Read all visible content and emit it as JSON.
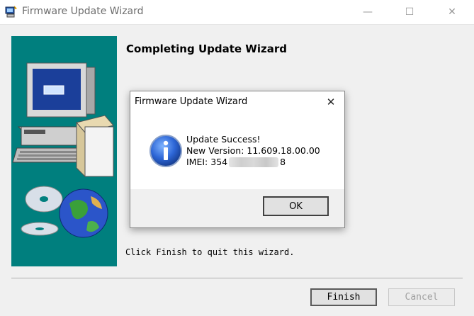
{
  "window": {
    "title": "Firmware Update Wizard",
    "controls": {
      "minimize": "—",
      "maximize": "☐",
      "close": "✕"
    }
  },
  "wizard": {
    "heading": "Completing Update Wizard",
    "hint": "Click Finish to quit this wizard.",
    "buttons": {
      "finish": "Finish",
      "cancel": "Cancel"
    },
    "icons": {
      "app": "wizard-app-icon",
      "side_art": "computer-and-globe-illustration"
    }
  },
  "dialog": {
    "title": "Firmware Update Wizard",
    "close": "✕",
    "icon": "info-icon",
    "lines": {
      "status": "Update Success!",
      "version": "New Version: 11.609.18.00.00",
      "imei_prefix": "IMEI: 354",
      "imei_suffix": "8"
    },
    "ok": "OK"
  },
  "colors": {
    "side_panel": "#007f7e",
    "dialog_bg": "#ffffff",
    "window_bg": "#f0f0f0"
  }
}
